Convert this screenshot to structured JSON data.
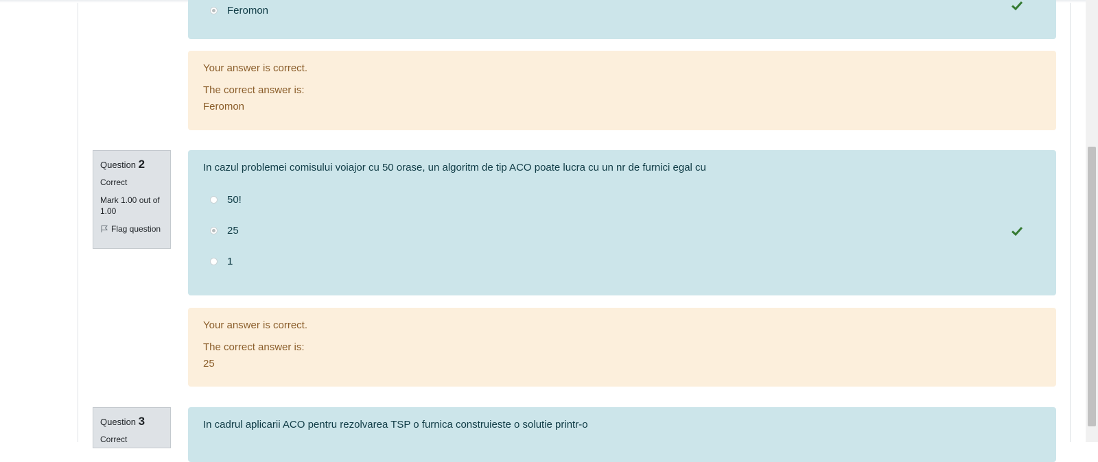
{
  "q1": {
    "partial_option": "Feromon",
    "feedback": {
      "result": "Your answer is correct.",
      "correct_label": "The correct answer is:",
      "correct_value": "Feromon"
    }
  },
  "q2": {
    "label": "Question",
    "number": "2",
    "state": "Correct",
    "mark": "Mark 1.00 out of 1.00",
    "flag_label": "Flag question",
    "text": "In cazul problemei comisului voiajor cu 50 orase, un algoritm de tip ACO poate lucra cu un nr de furnici egal cu",
    "options": [
      "50!",
      "25",
      "1"
    ],
    "selected_index": 1,
    "feedback": {
      "result": "Your answer is correct.",
      "correct_label": "The correct answer is:",
      "correct_value": "25"
    }
  },
  "q3": {
    "label": "Question",
    "number": "3",
    "state": "Correct",
    "text": "In cadrul aplicarii ACO pentru rezolvarea TSP o furnica construieste o solutie printr-o"
  },
  "colors": {
    "formulation_bg": "#cce5ea",
    "feedback_bg": "#fcefdc",
    "check_green": "#357a32",
    "info_bg": "#dee2e6"
  }
}
